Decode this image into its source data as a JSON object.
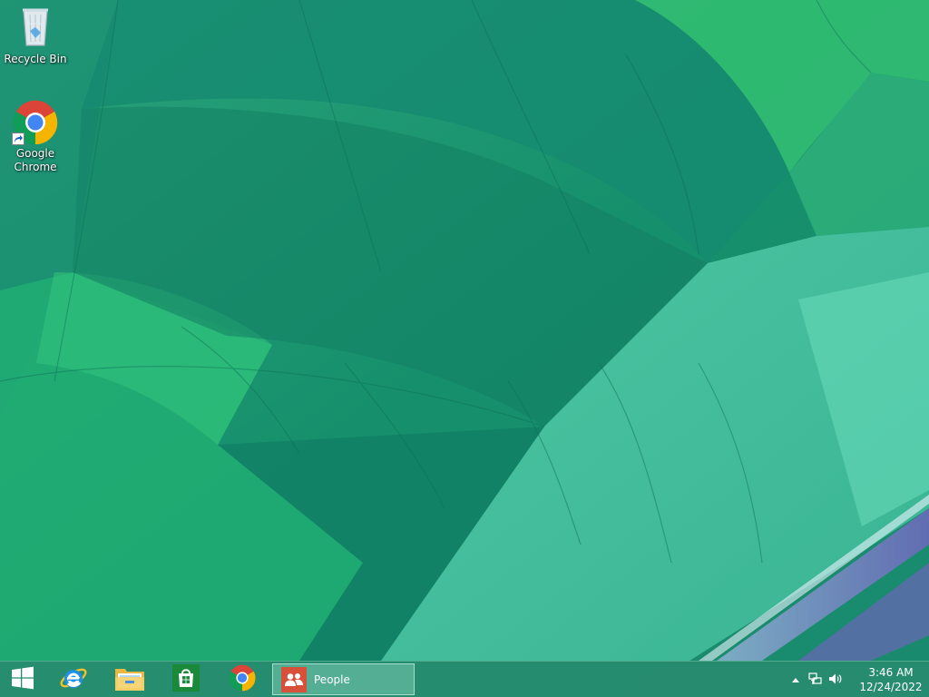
{
  "desktop": {
    "icons": [
      {
        "label": "Recycle Bin",
        "icon": "recycle-bin-icon"
      },
      {
        "label": "Google\nChrome",
        "label_line1": "Google",
        "label_line2": "Chrome",
        "icon": "chrome-icon"
      }
    ]
  },
  "taskbar": {
    "start_icon": "windows-logo-icon",
    "pinned": [
      {
        "name": "internet-explorer",
        "icon": "internet-explorer-icon"
      },
      {
        "name": "file-explorer",
        "icon": "folder-icon"
      },
      {
        "name": "store",
        "icon": "store-icon"
      },
      {
        "name": "chrome",
        "icon": "chrome-icon"
      }
    ],
    "running_app": {
      "label": "People",
      "icon": "people-icon",
      "color": "#d6503a"
    }
  },
  "tray": {
    "overflow_icon": "chevron-up-icon",
    "network_icon": "network-icon",
    "volume_icon": "speaker-icon",
    "time": "3:46 AM",
    "date": "12/24/2022"
  },
  "colors": {
    "wallpaper_base": "#1e9a74",
    "taskbar": "#2c8c70",
    "accent": "#d6503a"
  }
}
